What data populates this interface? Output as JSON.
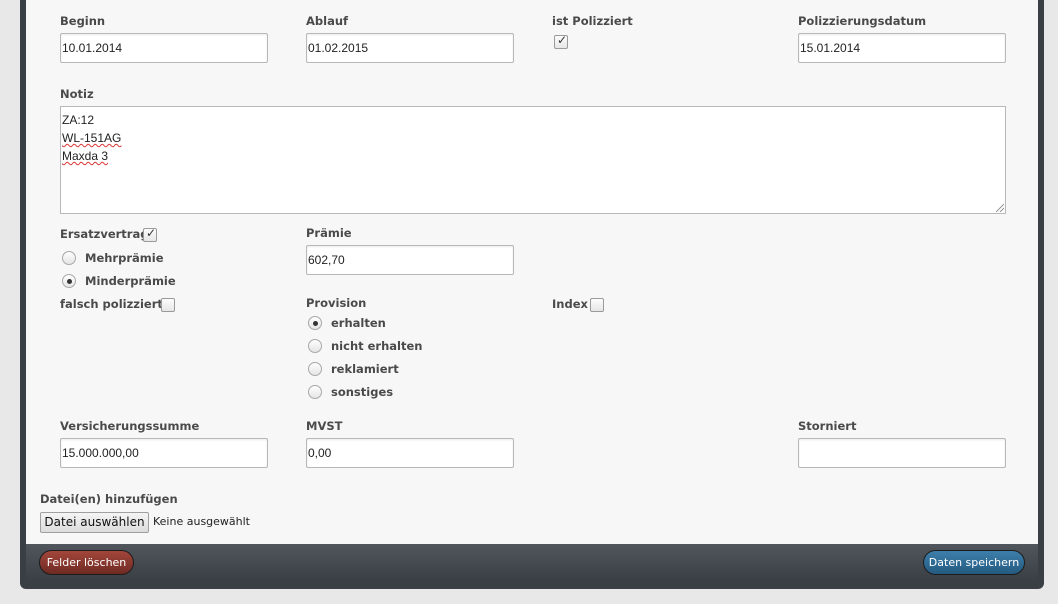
{
  "form": {
    "beginn": {
      "label": "Beginn",
      "value": "10.01.2014"
    },
    "ablauf": {
      "label": "Ablauf",
      "value": "01.02.2015"
    },
    "polizziert": {
      "label": "ist Polizziert",
      "checked": true
    },
    "polizzierungsdatum": {
      "label": "Polizzierungsdatum",
      "value": "15.01.2014"
    },
    "notiz": {
      "label": "Notiz",
      "lines": [
        "ZA:12",
        "WL-151AG",
        "Maxda 3"
      ]
    },
    "ersatzvertrag": {
      "label": "Ersatzvertrag",
      "checked": true
    },
    "praemie_type": {
      "options": [
        {
          "label": "Mehrprämie",
          "selected": false
        },
        {
          "label": "Minderprämie",
          "selected": true
        }
      ]
    },
    "praemie": {
      "label": "Prämie",
      "value": "602,70"
    },
    "falsch_polizziert": {
      "label": "falsch polizziert",
      "checked": false
    },
    "provision": {
      "label": "Provision",
      "options": [
        {
          "label": "erhalten",
          "selected": true
        },
        {
          "label": "nicht erhalten",
          "selected": false
        },
        {
          "label": "reklamiert",
          "selected": false
        },
        {
          "label": "sonstiges",
          "selected": false
        }
      ]
    },
    "index": {
      "label": "Index",
      "checked": false
    },
    "versicherungssumme": {
      "label": "Versicherungssumme",
      "value": "15.000.000,00"
    },
    "mvst": {
      "label": "MVST",
      "value": "0,00"
    },
    "storniert": {
      "label": "Storniert",
      "value": ""
    },
    "dateien": {
      "label": "Datei(en) hinzufügen",
      "button": "Datei auswählen",
      "status": "Keine ausgewählt"
    }
  },
  "footer": {
    "clear_label": "Felder löschen",
    "save_label": "Daten speichern",
    "clear_color": "#8a3a30",
    "save_color": "#2f6d97"
  }
}
